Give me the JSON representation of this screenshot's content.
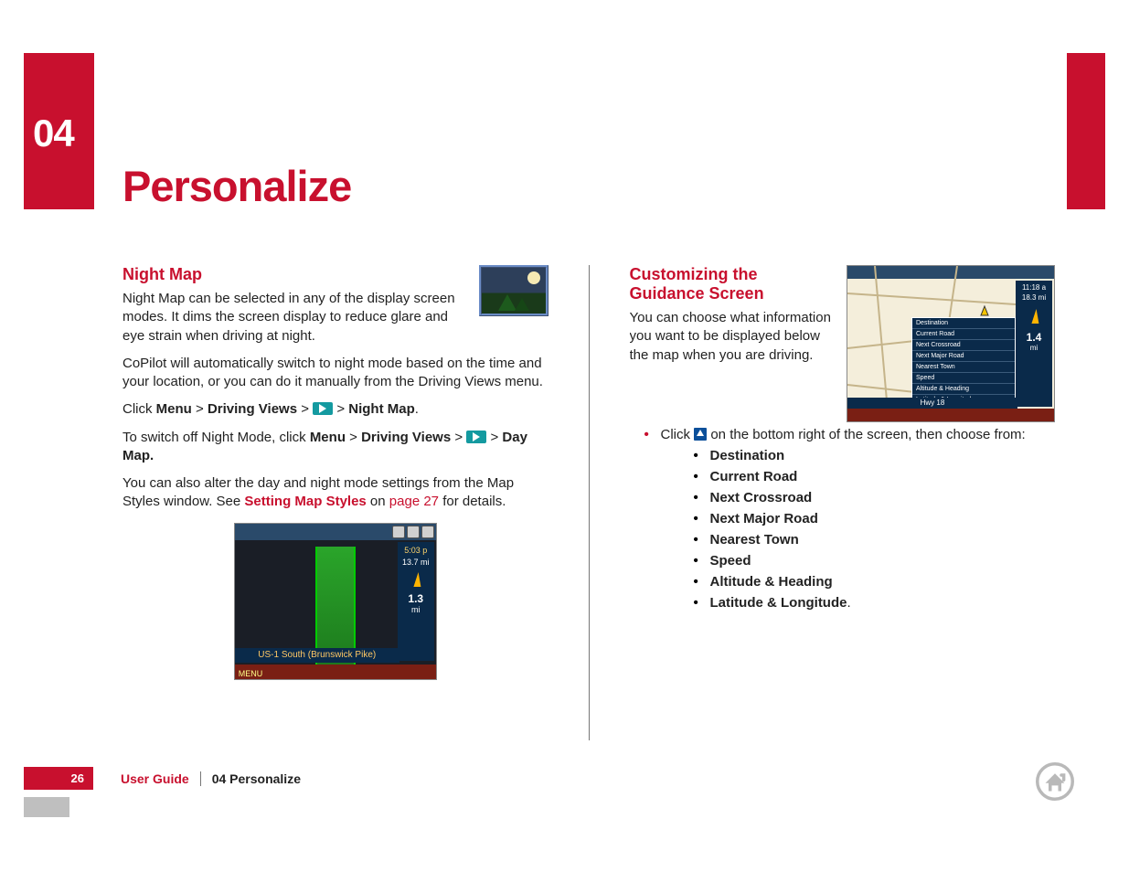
{
  "chapter": {
    "number": "04",
    "title": "Personalize"
  },
  "left": {
    "h": "Night Map",
    "p1": "Night Map can be selected in any of the display screen modes. It dims the screen display to reduce glare and eye strain when driving at night.",
    "p2": "CoPilot will automatically switch to night mode based on the time and your location, or you can do it manually from the Driving Views menu.",
    "path1": {
      "pre": "Click ",
      "a": "Menu",
      "sep": " > ",
      "b": "Driving Views",
      "c": "Night Map",
      "end": "."
    },
    "path2": {
      "pre": "To switch off Night Mode, click ",
      "a": "Menu",
      "sep": " > ",
      "b": "Driving Views",
      "c": "Day Map."
    },
    "p3a": "You can also alter the day and night mode settings from the Map Styles window. See ",
    "p3link": "Setting Map Styles",
    "p3mid": " on ",
    "p3page": "page 27",
    "p3end": " for details.",
    "shot": {
      "time": "5:03 p",
      "dist": "13.7 mi",
      "big": "1.3",
      "unit": "mi",
      "road": "US-1 South (Brunswick Pike)",
      "menu": "MENU"
    }
  },
  "right": {
    "h": "Customizing the Guidance Screen",
    "p1": "You can choose what information you want to be displayed below the map when you are driving.",
    "bullet1a": "Click ",
    "bullet1b": " on the bottom right of the screen, then choose from:",
    "options": [
      "Destination",
      "Current Road",
      "Next Crossroad",
      "Next Major Road",
      "Nearest Town",
      "Speed",
      "Altitude & Heading",
      "Latitude & Longitude"
    ],
    "last_punct": ".",
    "shot": {
      "time": "11:18 a",
      "dist": "18.3 mi",
      "big": "1.4",
      "unit": "mi",
      "hwy": "Hwy 18",
      "menu": [
        "Destination",
        "Current Road",
        "Next Crossroad",
        "Next Major Road",
        "Nearest Town",
        "Speed",
        "Altitude & Heading",
        "Latitude & Longitude"
      ]
    }
  },
  "footer": {
    "page": "26",
    "user_guide": "User Guide",
    "section": "04 Personalize"
  }
}
